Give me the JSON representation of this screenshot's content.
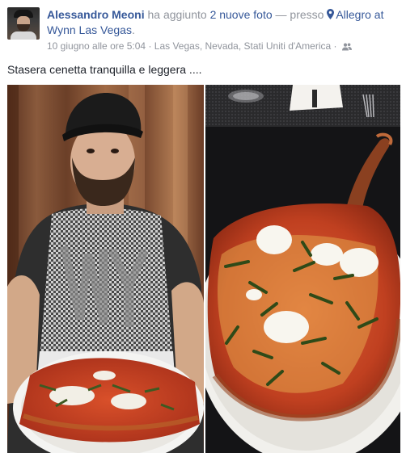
{
  "post": {
    "author": "Alessandro Meoni",
    "action": " ha aggiunto ",
    "photos_count": "2 nuove foto",
    "sep": " — presso ",
    "place": "Allegro at Wynn Las Vegas",
    "place_end": ".",
    "timestamp": "10 giugno alle ore 5:04",
    "dot": " · ",
    "location": "Las Vegas, Nevada, Stati Uniti d'America",
    "dot2": " · ",
    "audience_icon": "friends-icon",
    "place_icon": "map-pin-icon",
    "text": "Stasera cenetta tranquilla e leggera ...."
  },
  "colors": {
    "link": "#365899",
    "meta": "#90949c",
    "text": "#1d2129"
  }
}
